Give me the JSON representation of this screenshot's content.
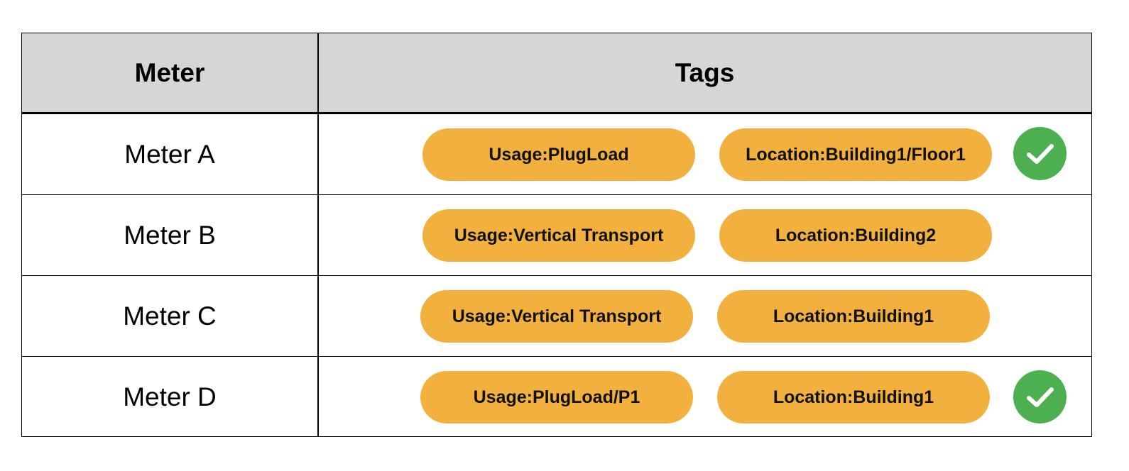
{
  "header": {
    "meter_label": "Meter",
    "tags_label": "Tags"
  },
  "rows": [
    {
      "meter": "Meter A",
      "tags": [
        "Usage:PlugLoad",
        "Location:Building1/Floor1"
      ],
      "checked": true
    },
    {
      "meter": "Meter B",
      "tags": [
        "Usage:Vertical Transport",
        "Location:Building2"
      ],
      "checked": false
    },
    {
      "meter": "Meter C",
      "tags": [
        "Usage:Vertical Transport",
        "Location:Building1"
      ],
      "checked": false
    },
    {
      "meter": "Meter D",
      "tags": [
        "Usage:PlugLoad/P1",
        "Location:Building1"
      ],
      "checked": true
    }
  ],
  "colors": {
    "tag_fill": "#f2b13e",
    "check_fill": "#4caf50",
    "header_fill": "#d6d6d6"
  },
  "icons": {
    "check": "check-icon"
  }
}
